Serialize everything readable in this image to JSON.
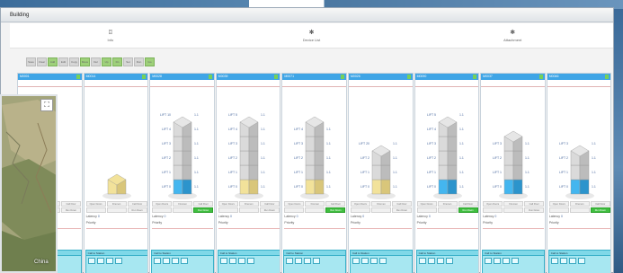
{
  "window": {
    "title": "Building"
  },
  "tabs": [
    {
      "icon": "cylinder-icon",
      "glyph": "⌼",
      "label": "Info"
    },
    {
      "icon": "gear-icon",
      "glyph": "✱",
      "label": "Device List"
    },
    {
      "icon": "settings-icon",
      "glyph": "✱",
      "label": "Attachment"
    }
  ],
  "toolbar": {
    "buttons": [
      {
        "label": "Save",
        "green": false
      },
      {
        "label": "Clear",
        "green": false
      },
      {
        "label": "Add",
        "green": true
      },
      {
        "label": "Edit",
        "green": false
      },
      {
        "label": "Copy",
        "green": false
      },
      {
        "label": "Move",
        "green": true
      },
      {
        "label": "Del",
        "green": false
      },
      {
        "label": "Up",
        "green": true
      },
      {
        "label": "Dn",
        "green": true
      },
      {
        "label": "Set",
        "green": false
      },
      {
        "label": "Run",
        "green": false
      },
      {
        "label": "Go",
        "green": true
      }
    ]
  },
  "panels": [
    {
      "id": "M0001",
      "floors": 0,
      "building": false,
      "tall": 0,
      "color": "none",
      "labels": []
    },
    {
      "id": "M0014",
      "floors": 1,
      "building": true,
      "tall": 0,
      "color": "yellow",
      "labels": []
    },
    {
      "id": "M0028",
      "floors": 5,
      "building": true,
      "tall": 5,
      "color": "blue",
      "labels": [
        "10",
        "4",
        "3",
        "2",
        "1",
        "0"
      ]
    },
    {
      "id": "M0039",
      "floors": 5,
      "building": true,
      "tall": 5,
      "color": "yellow",
      "labels": [
        "5",
        "4",
        "3",
        "2",
        "1",
        "0"
      ]
    },
    {
      "id": "M0071",
      "floors": 5,
      "building": true,
      "tall": 5,
      "color": "yellow",
      "labels": [
        "4",
        "3",
        "2",
        "1",
        "0"
      ]
    },
    {
      "id": "M0026",
      "floors": 3,
      "building": true,
      "tall": 3,
      "color": "yellow",
      "labels": [
        "20",
        "2",
        "1",
        "0"
      ]
    },
    {
      "id": "M0090",
      "floors": 5,
      "building": true,
      "tall": 5,
      "color": "blue",
      "labels": [
        "5",
        "4",
        "3",
        "2",
        "1",
        "0"
      ]
    },
    {
      "id": "M0037",
      "floors": 4,
      "building": true,
      "tall": 4,
      "color": "blue",
      "labels": [
        "3",
        "2",
        "1",
        "0"
      ]
    },
    {
      "id": "M0046",
      "floors": 3,
      "building": true,
      "tall": 3,
      "color": "blue",
      "labels": [
        "3",
        "2",
        "1",
        "0"
      ]
    }
  ],
  "panel_common": {
    "ctrl_buttons": [
      "Open Doors",
      "Firemen",
      "Call Floor"
    ],
    "run_label": "Run Down",
    "latency_label": "Latency",
    "latency_value": "0",
    "priority_label": "Priority",
    "cyan_header": "Call to Station",
    "cyan_tabs": [
      "Call 1",
      "Call 2"
    ]
  },
  "map": {
    "label": "China"
  }
}
